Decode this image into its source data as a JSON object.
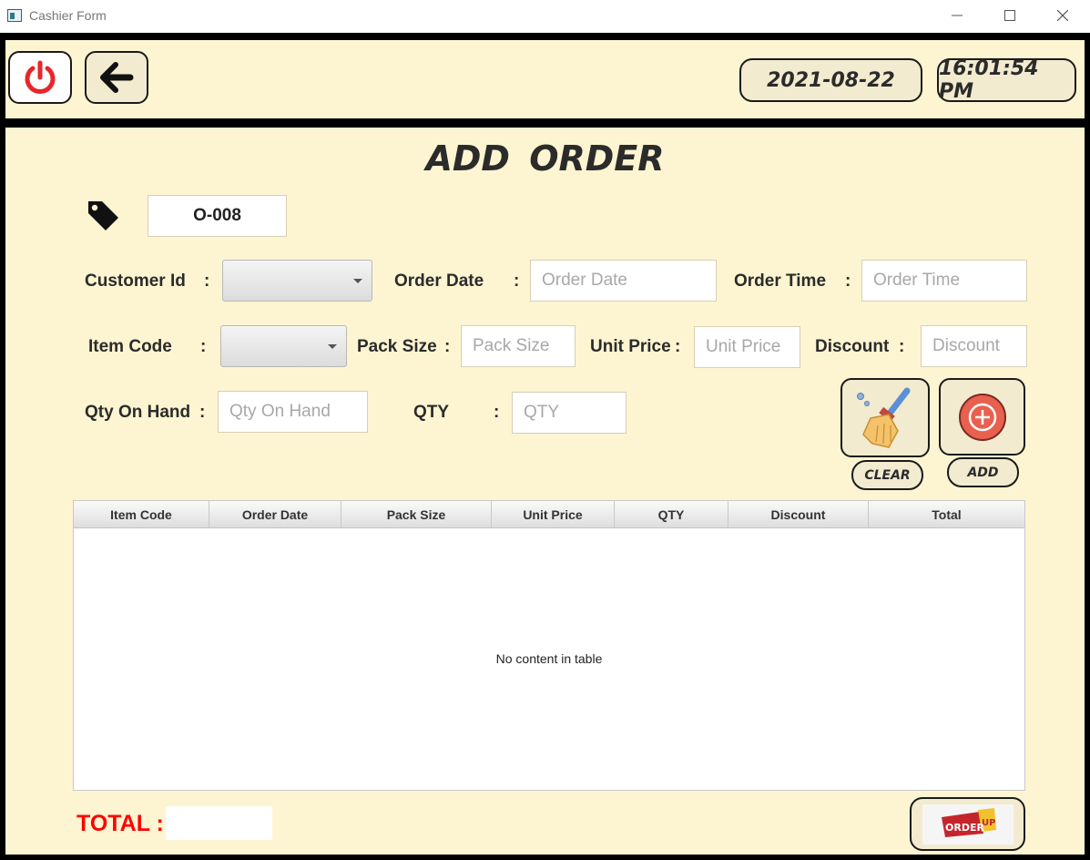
{
  "window": {
    "title": "Cashier Form"
  },
  "header": {
    "date": "2021-08-22",
    "time": "16:01:54 PM"
  },
  "form": {
    "heading": "ADD  ORDER",
    "order_id": "O-008",
    "colon": ":",
    "labels": {
      "customer_id": "Customer Id",
      "order_date": "Order Date",
      "order_time": "Order Time",
      "item_code": "Item Code",
      "pack_size": "Pack Size",
      "unit_price": "Unit Price",
      "discount": "Discount",
      "qty_on_hand": "Qty On Hand",
      "qty": "QTY"
    },
    "placeholders": {
      "order_date": "Order Date",
      "order_time": "Order Time",
      "pack_size": "Pack Size",
      "unit_price": "Unit Price",
      "discount": "Discount",
      "qty_on_hand": "Qty On Hand",
      "qty": "QTY"
    },
    "clear_label": "CLEAR",
    "add_label": "ADD"
  },
  "table": {
    "columns": [
      "Item Code",
      "Order Date",
      "Pack Size",
      "Unit Price",
      "QTY",
      "Discount",
      "Total"
    ],
    "empty_message": "No content in table"
  },
  "footer": {
    "total_label": "TOTAL :",
    "total_value": "",
    "logo_text_1": "ORDER",
    "logo_text_2": "UP"
  },
  "icons": [
    "power-icon",
    "back-arrow-icon",
    "tag-icon",
    "broom-icon",
    "add-circle-icon",
    "order-up-logo"
  ],
  "colors": {
    "panel_bg": "#fdf5d1",
    "frame": "#000000",
    "total_label": "#ff0000",
    "power_icon": "#e8262a",
    "add_icon": "#e9604f"
  }
}
